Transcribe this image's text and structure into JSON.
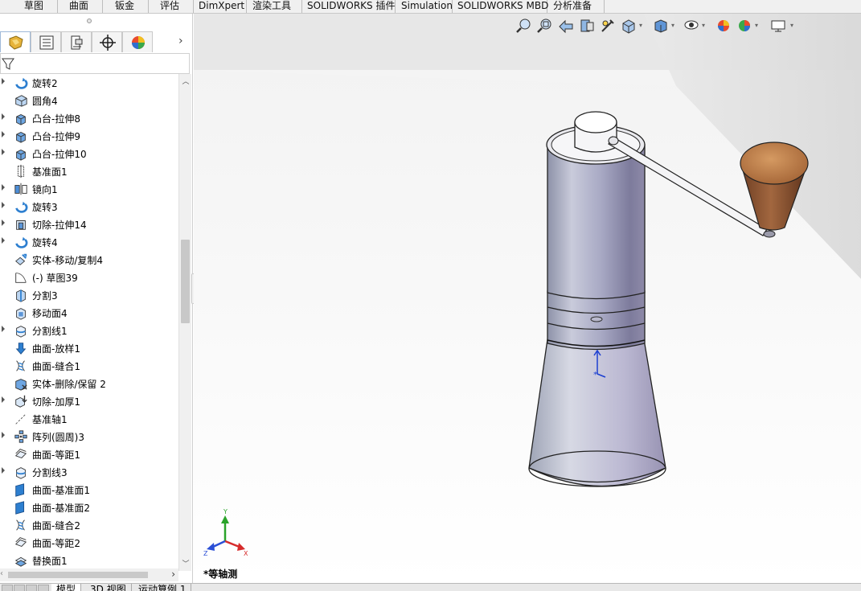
{
  "command_tabs": [
    "草图",
    "曲面",
    "钣金",
    "评估",
    "DimXpert",
    "渲染工具",
    "SOLIDWORKS 插件",
    "Simulation",
    "SOLIDWORKS MBD",
    "分析准备"
  ],
  "feature_tree": [
    {
      "label": "旋转2",
      "icon": "revolve-icon",
      "expandable": true
    },
    {
      "label": "圆角4",
      "icon": "fillet-icon",
      "expandable": false
    },
    {
      "label": "凸台-拉伸8",
      "icon": "extrude-boss-icon",
      "expandable": true
    },
    {
      "label": "凸台-拉伸9",
      "icon": "extrude-boss-icon",
      "expandable": true
    },
    {
      "label": "凸台-拉伸10",
      "icon": "extrude-boss-icon",
      "expandable": true
    },
    {
      "label": "基准面1",
      "icon": "plane-icon",
      "expandable": false
    },
    {
      "label": "镜向1",
      "icon": "mirror-icon",
      "expandable": true
    },
    {
      "label": "旋转3",
      "icon": "revolve-icon",
      "expandable": true
    },
    {
      "label": "切除-拉伸14",
      "icon": "extrude-cut-icon",
      "expandable": true
    },
    {
      "label": "旋转4",
      "icon": "revolve-icon",
      "expandable": true
    },
    {
      "label": "实体-移动/复制4",
      "icon": "move-copy-body-icon",
      "expandable": false
    },
    {
      "label": "(-) 草图39",
      "icon": "sketch-icon",
      "expandable": false
    },
    {
      "label": "分割3",
      "icon": "split-icon",
      "expandable": false
    },
    {
      "label": "移动面4",
      "icon": "move-face-icon",
      "expandable": false
    },
    {
      "label": "分割线1",
      "icon": "split-line-icon",
      "expandable": true
    },
    {
      "label": "曲面-放样1",
      "icon": "surface-loft-icon",
      "expandable": false
    },
    {
      "label": "曲面-缝合1",
      "icon": "surface-knit-icon",
      "expandable": false
    },
    {
      "label": "实体-删除/保留 2",
      "icon": "delete-body-icon",
      "expandable": false
    },
    {
      "label": "切除-加厚1",
      "icon": "thicken-cut-icon",
      "expandable": true
    },
    {
      "label": "基准轴1",
      "icon": "axis-icon",
      "expandable": false
    },
    {
      "label": "阵列(圆周)3",
      "icon": "circular-pattern-icon",
      "expandable": true
    },
    {
      "label": "曲面-等距1",
      "icon": "surface-offset-icon",
      "expandable": false
    },
    {
      "label": "分割线3",
      "icon": "split-line-icon",
      "expandable": true
    },
    {
      "label": "曲面-基准面1",
      "icon": "planar-surface-icon",
      "expandable": false
    },
    {
      "label": "曲面-基准面2",
      "icon": "planar-surface-icon",
      "expandable": false
    },
    {
      "label": "曲面-缝合2",
      "icon": "surface-knit-icon",
      "expandable": false
    },
    {
      "label": "曲面-等距2",
      "icon": "surface-offset-icon",
      "expandable": false
    },
    {
      "label": "替换面1",
      "icon": "replace-face-icon",
      "expandable": false
    }
  ],
  "manager_tabs": [
    "feature-manager-icon",
    "property-manager-icon",
    "configuration-manager-icon",
    "dimxpert-manager-icon",
    "display-manager-icon"
  ],
  "viewport": {
    "view_label": "*等轴测",
    "triad_axes": [
      "Y",
      "Z",
      "X"
    ]
  },
  "bottom_tabs": [
    "模型",
    "3D 视图",
    "运动算例 1"
  ],
  "colors": {
    "accent": "#2b6fc7",
    "tree_icon": "#3d8ed8",
    "handle_wood": "#8b5a3a"
  }
}
